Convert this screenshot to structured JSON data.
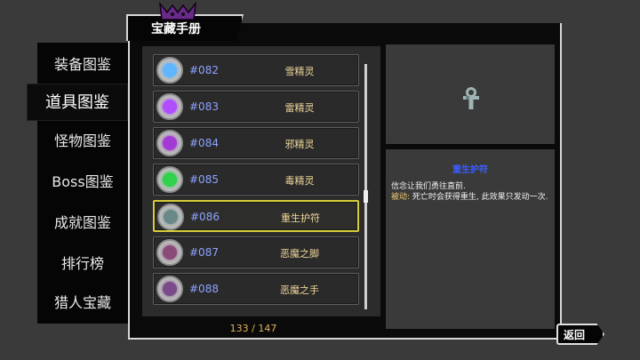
{
  "title_tab": {
    "label": "宝藏手册"
  },
  "nav": {
    "items": [
      {
        "label": "装备图鉴",
        "active": false
      },
      {
        "label": "道具图鉴",
        "active": true
      },
      {
        "label": "怪物图鉴",
        "active": false
      },
      {
        "label": "Boss图鉴",
        "active": false
      },
      {
        "label": "成就图鉴",
        "active": false
      },
      {
        "label": "排行榜",
        "active": false
      },
      {
        "label": "猎人宝藏",
        "active": false
      }
    ]
  },
  "list": {
    "rows": [
      {
        "number": "#082",
        "name": "雪精灵",
        "icon": "snow-spirit-icon",
        "color": "#5fb6ff",
        "selected": false
      },
      {
        "number": "#083",
        "name": "雷精灵",
        "icon": "thunder-spirit-icon",
        "color": "#b04dff",
        "selected": false
      },
      {
        "number": "#084",
        "name": "邪精灵",
        "icon": "evil-spirit-icon",
        "color": "#a43ad6",
        "selected": false
      },
      {
        "number": "#085",
        "name": "毒精灵",
        "icon": "poison-spirit-icon",
        "color": "#2fd24a",
        "selected": false
      },
      {
        "number": "#086",
        "name": "重生护符",
        "icon": "rebirth-amulet-icon",
        "color": "#6a8a8a",
        "selected": true
      },
      {
        "number": "#087",
        "name": "恶魔之脚",
        "icon": "demon-foot-icon",
        "color": "#8a4a7a",
        "selected": false
      },
      {
        "number": "#088",
        "name": "恶魔之手",
        "icon": "demon-hand-icon",
        "color": "#7a4a8a",
        "selected": false
      }
    ],
    "counter": "133 / 147"
  },
  "detail": {
    "title": "重生护符",
    "line1": "信念让我们勇往直前.",
    "passive_key": "被动:",
    "passive_text": " 死亡时会获得重生, 此效果只发动一次."
  },
  "back_button": {
    "label": "返回"
  },
  "colors": {
    "accent": "#d6cf3a",
    "number": "#8ea3ff",
    "name": "#efd79a",
    "title": "#3c5cff"
  }
}
